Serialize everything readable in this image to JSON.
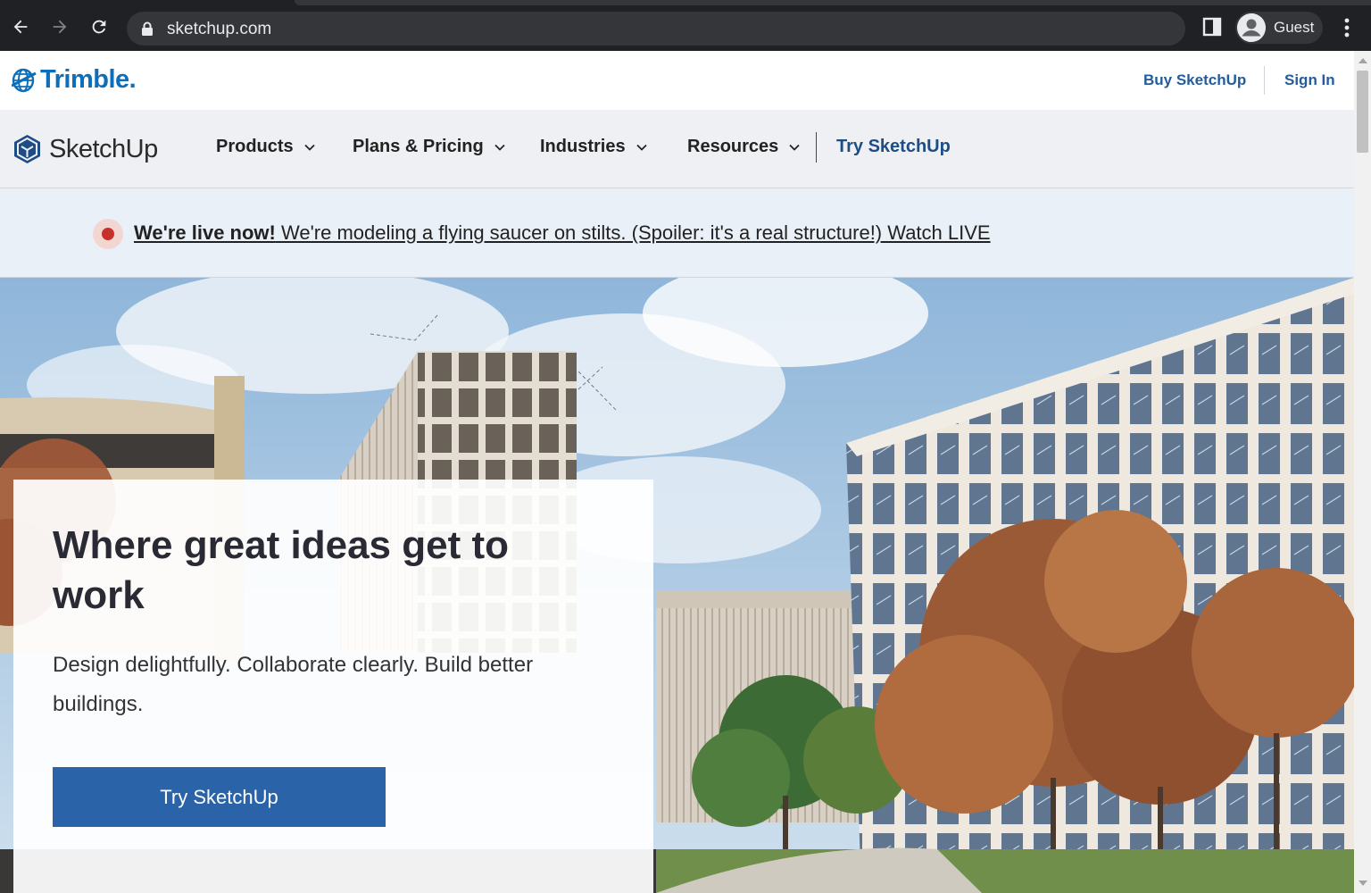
{
  "browser": {
    "url": "sketchup.com",
    "profile_label": "Guest"
  },
  "trimble": {
    "logo_text": "Trimble.",
    "buy_label": "Buy SketchUp",
    "signin_label": "Sign In"
  },
  "nav": {
    "logo_text": "SketchUp",
    "items": [
      {
        "label": "Products"
      },
      {
        "label": "Plans & Pricing"
      },
      {
        "label": "Industries"
      },
      {
        "label": "Resources"
      }
    ],
    "try_label": "Try SketchUp"
  },
  "banner": {
    "strong": "We're live now!",
    "text": " We're modeling a flying saucer on stilts. (Spoiler: it's a real structure!) Watch LIVE"
  },
  "hero": {
    "title": "Where great ideas get to work",
    "subtitle": "Design delightfully. Collaborate clearly. Build better buildings.",
    "cta_label": "Try SketchUp"
  },
  "colors": {
    "brand_blue": "#2b63a8",
    "link_blue": "#245c9c",
    "live_red": "#c8302b"
  }
}
